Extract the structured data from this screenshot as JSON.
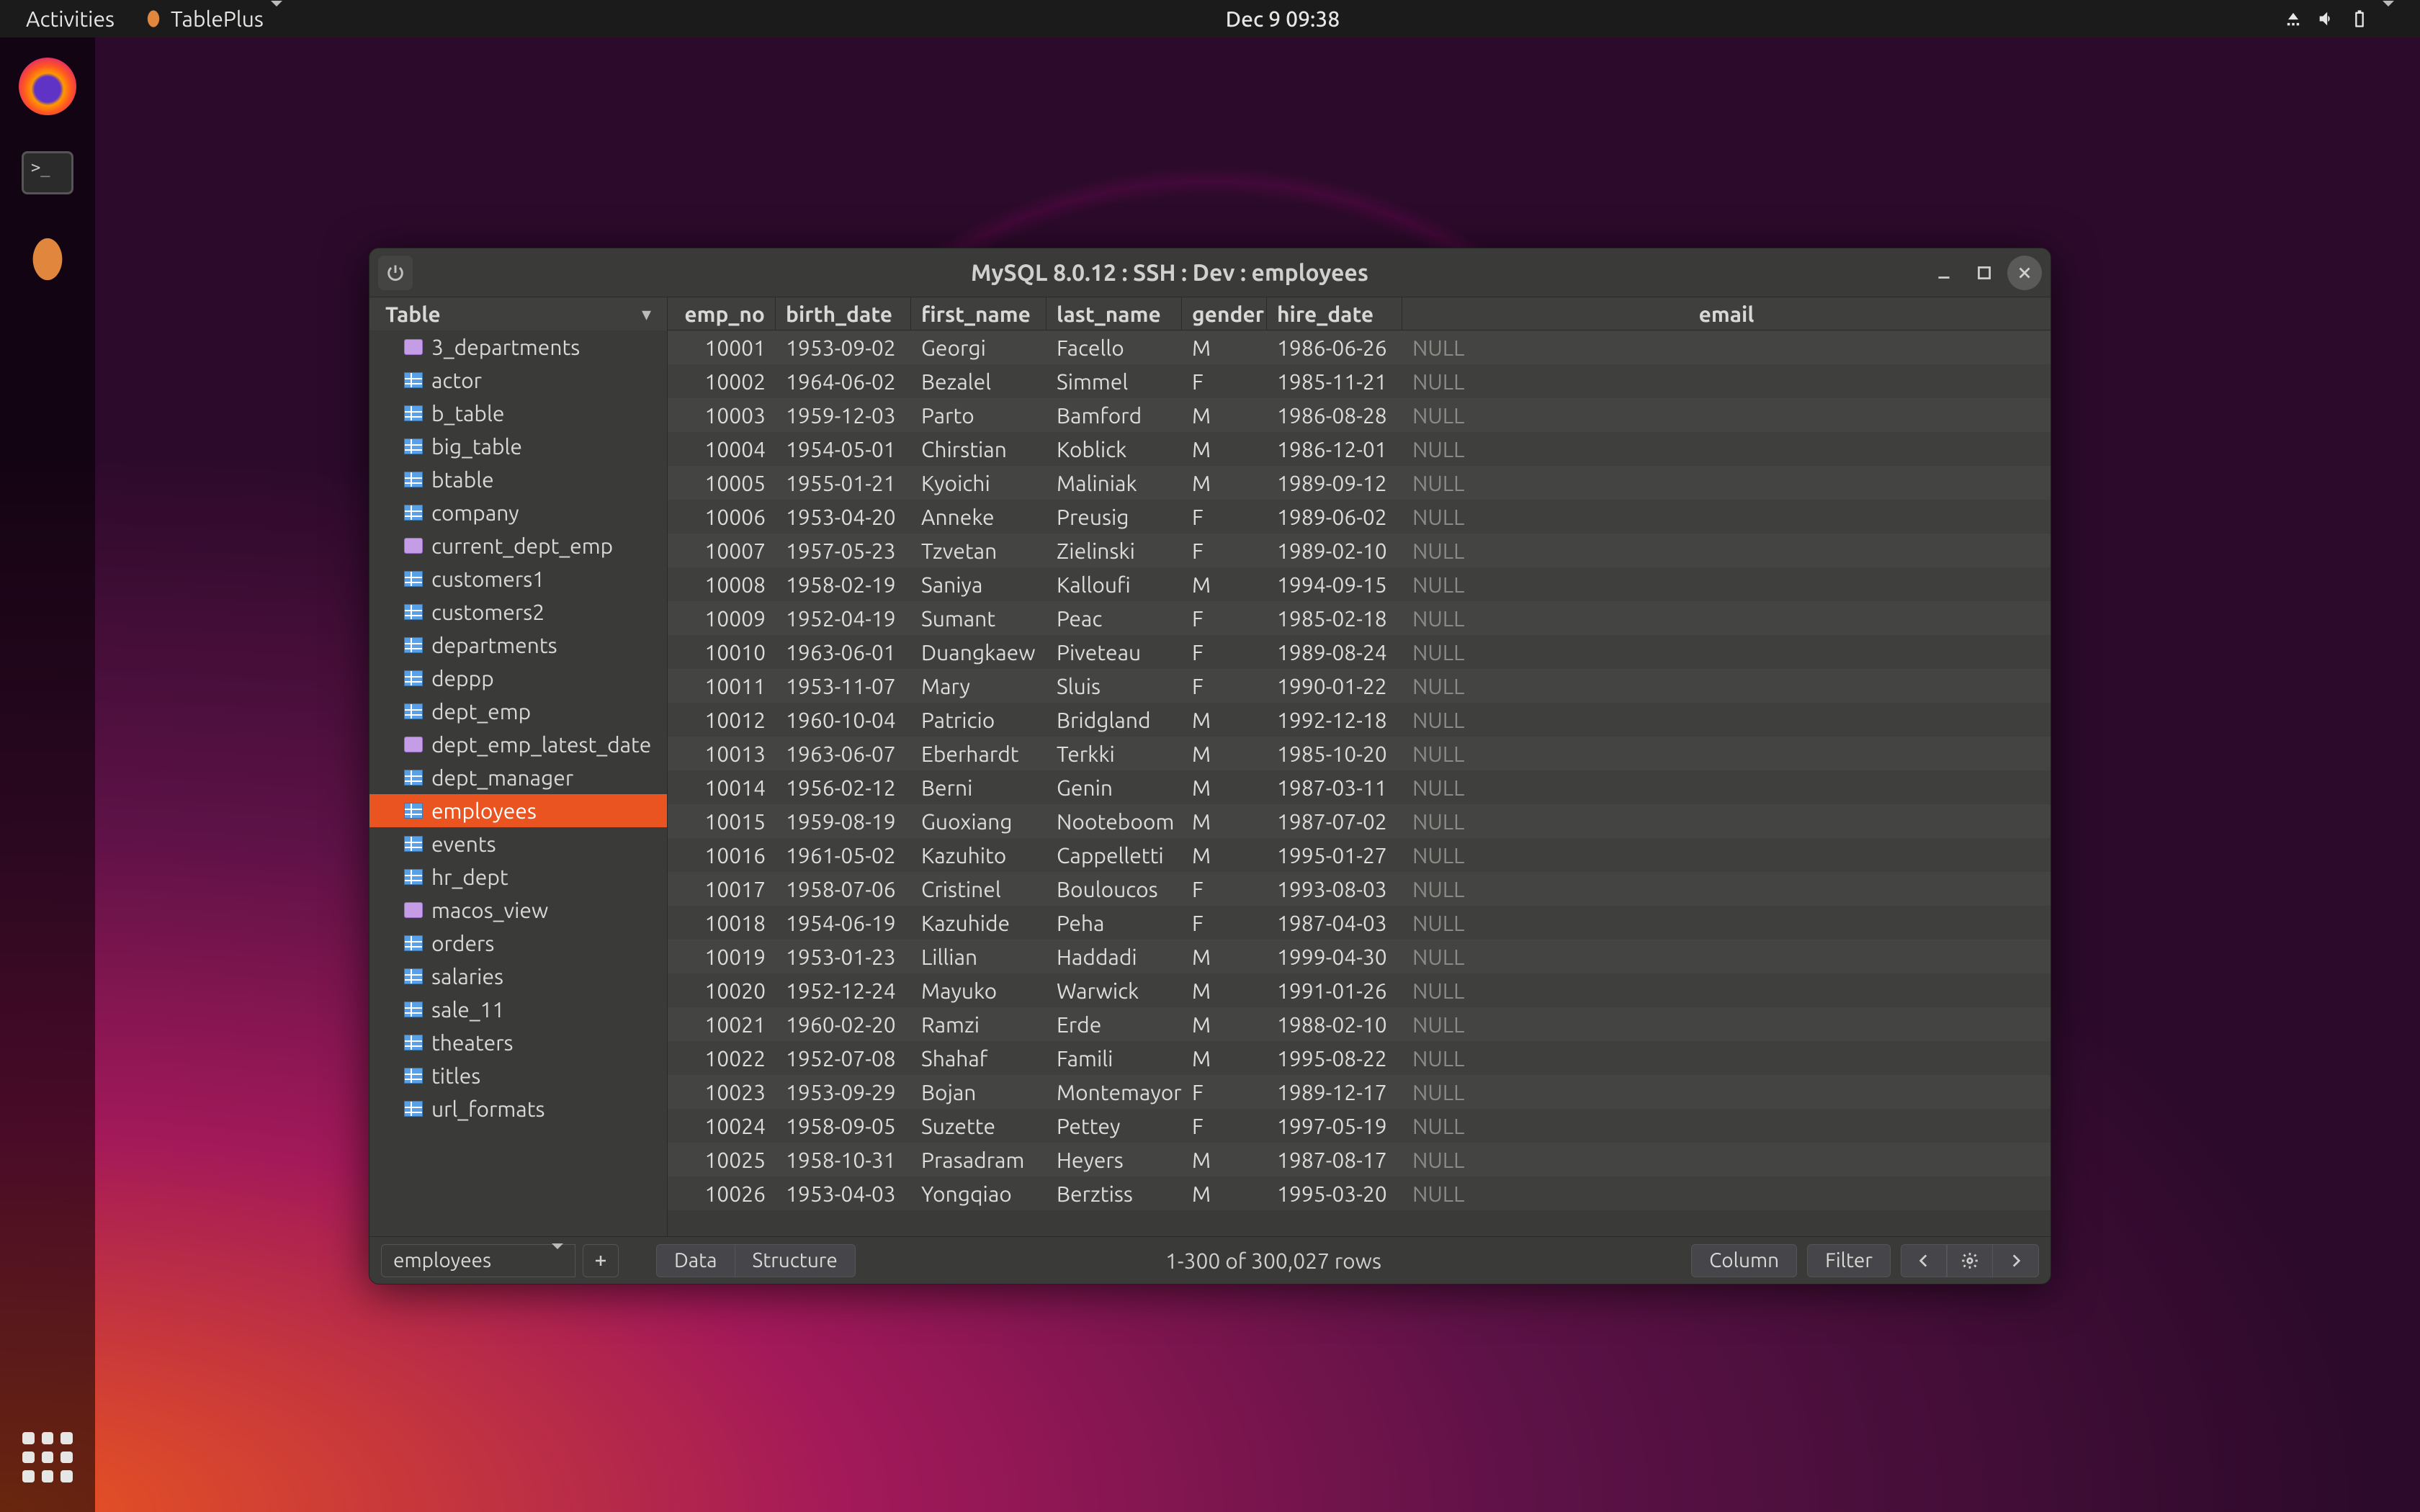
{
  "top_panel": {
    "activities": "Activities",
    "app_name": "TablePlus",
    "clock": "Dec 9  09:38"
  },
  "window": {
    "title": "MySQL 8.0.12  :  SSH  :  Dev  :  employees"
  },
  "sidebar": {
    "header": "Table",
    "tables": [
      {
        "name": "3_departments",
        "type": "view"
      },
      {
        "name": "actor",
        "type": "grid"
      },
      {
        "name": "b_table",
        "type": "grid"
      },
      {
        "name": "big_table",
        "type": "grid"
      },
      {
        "name": "btable",
        "type": "grid"
      },
      {
        "name": "company",
        "type": "grid"
      },
      {
        "name": "current_dept_emp",
        "type": "view"
      },
      {
        "name": "customers1",
        "type": "grid"
      },
      {
        "name": "customers2",
        "type": "grid"
      },
      {
        "name": "departments",
        "type": "grid"
      },
      {
        "name": "deppp",
        "type": "grid"
      },
      {
        "name": "dept_emp",
        "type": "grid"
      },
      {
        "name": "dept_emp_latest_date",
        "type": "view"
      },
      {
        "name": "dept_manager",
        "type": "grid"
      },
      {
        "name": "employees",
        "type": "grid",
        "selected": true
      },
      {
        "name": "events",
        "type": "grid"
      },
      {
        "name": "hr_dept",
        "type": "grid"
      },
      {
        "name": "macos_view",
        "type": "view"
      },
      {
        "name": "orders",
        "type": "grid"
      },
      {
        "name": "salaries",
        "type": "grid"
      },
      {
        "name": "sale_11",
        "type": "grid"
      },
      {
        "name": "theaters",
        "type": "grid"
      },
      {
        "name": "titles",
        "type": "grid"
      },
      {
        "name": "url_formats",
        "type": "grid"
      }
    ]
  },
  "columns": {
    "emp_no": "emp_no",
    "birth_date": "birth_date",
    "first_name": "first_name",
    "last_name": "last_name",
    "gender": "gender",
    "hire_date": "hire_date",
    "email": "email"
  },
  "rows": [
    {
      "emp_no": "10001",
      "birth_date": "1953-09-02",
      "first_name": "Georgi",
      "last_name": "Facello",
      "gender": "M",
      "hire_date": "1986-06-26",
      "email": "NULL"
    },
    {
      "emp_no": "10002",
      "birth_date": "1964-06-02",
      "first_name": "Bezalel",
      "last_name": "Simmel",
      "gender": "F",
      "hire_date": "1985-11-21",
      "email": "NULL"
    },
    {
      "emp_no": "10003",
      "birth_date": "1959-12-03",
      "first_name": "Parto",
      "last_name": "Bamford",
      "gender": "M",
      "hire_date": "1986-08-28",
      "email": "NULL"
    },
    {
      "emp_no": "10004",
      "birth_date": "1954-05-01",
      "first_name": "Chirstian",
      "last_name": "Koblick",
      "gender": "M",
      "hire_date": "1986-12-01",
      "email": "NULL"
    },
    {
      "emp_no": "10005",
      "birth_date": "1955-01-21",
      "first_name": "Kyoichi",
      "last_name": "Maliniak",
      "gender": "M",
      "hire_date": "1989-09-12",
      "email": "NULL"
    },
    {
      "emp_no": "10006",
      "birth_date": "1953-04-20",
      "first_name": "Anneke",
      "last_name": "Preusig",
      "gender": "F",
      "hire_date": "1989-06-02",
      "email": "NULL"
    },
    {
      "emp_no": "10007",
      "birth_date": "1957-05-23",
      "first_name": "Tzvetan",
      "last_name": "Zielinski",
      "gender": "F",
      "hire_date": "1989-02-10",
      "email": "NULL"
    },
    {
      "emp_no": "10008",
      "birth_date": "1958-02-19",
      "first_name": "Saniya",
      "last_name": "Kalloufi",
      "gender": "M",
      "hire_date": "1994-09-15",
      "email": "NULL"
    },
    {
      "emp_no": "10009",
      "birth_date": "1952-04-19",
      "first_name": "Sumant",
      "last_name": "Peac",
      "gender": "F",
      "hire_date": "1985-02-18",
      "email": "NULL"
    },
    {
      "emp_no": "10010",
      "birth_date": "1963-06-01",
      "first_name": "Duangkaew",
      "last_name": "Piveteau",
      "gender": "F",
      "hire_date": "1989-08-24",
      "email": "NULL"
    },
    {
      "emp_no": "10011",
      "birth_date": "1953-11-07",
      "first_name": "Mary",
      "last_name": "Sluis",
      "gender": "F",
      "hire_date": "1990-01-22",
      "email": "NULL"
    },
    {
      "emp_no": "10012",
      "birth_date": "1960-10-04",
      "first_name": "Patricio",
      "last_name": "Bridgland",
      "gender": "M",
      "hire_date": "1992-12-18",
      "email": "NULL"
    },
    {
      "emp_no": "10013",
      "birth_date": "1963-06-07",
      "first_name": "Eberhardt",
      "last_name": "Terkki",
      "gender": "M",
      "hire_date": "1985-10-20",
      "email": "NULL"
    },
    {
      "emp_no": "10014",
      "birth_date": "1956-02-12",
      "first_name": "Berni",
      "last_name": "Genin",
      "gender": "M",
      "hire_date": "1987-03-11",
      "email": "NULL"
    },
    {
      "emp_no": "10015",
      "birth_date": "1959-08-19",
      "first_name": "Guoxiang",
      "last_name": "Nooteboom",
      "gender": "M",
      "hire_date": "1987-07-02",
      "email": "NULL"
    },
    {
      "emp_no": "10016",
      "birth_date": "1961-05-02",
      "first_name": "Kazuhito",
      "last_name": "Cappelletti",
      "gender": "M",
      "hire_date": "1995-01-27",
      "email": "NULL"
    },
    {
      "emp_no": "10017",
      "birth_date": "1958-07-06",
      "first_name": "Cristinel",
      "last_name": "Bouloucos",
      "gender": "F",
      "hire_date": "1993-08-03",
      "email": "NULL"
    },
    {
      "emp_no": "10018",
      "birth_date": "1954-06-19",
      "first_name": "Kazuhide",
      "last_name": "Peha",
      "gender": "F",
      "hire_date": "1987-04-03",
      "email": "NULL"
    },
    {
      "emp_no": "10019",
      "birth_date": "1953-01-23",
      "first_name": "Lillian",
      "last_name": "Haddadi",
      "gender": "M",
      "hire_date": "1999-04-30",
      "email": "NULL"
    },
    {
      "emp_no": "10020",
      "birth_date": "1952-12-24",
      "first_name": "Mayuko",
      "last_name": "Warwick",
      "gender": "M",
      "hire_date": "1991-01-26",
      "email": "NULL"
    },
    {
      "emp_no": "10021",
      "birth_date": "1960-02-20",
      "first_name": "Ramzi",
      "last_name": "Erde",
      "gender": "M",
      "hire_date": "1988-02-10",
      "email": "NULL"
    },
    {
      "emp_no": "10022",
      "birth_date": "1952-07-08",
      "first_name": "Shahaf",
      "last_name": "Famili",
      "gender": "M",
      "hire_date": "1995-08-22",
      "email": "NULL"
    },
    {
      "emp_no": "10023",
      "birth_date": "1953-09-29",
      "first_name": "Bojan",
      "last_name": "Montemayor",
      "gender": "F",
      "hire_date": "1989-12-17",
      "email": "NULL"
    },
    {
      "emp_no": "10024",
      "birth_date": "1958-09-05",
      "first_name": "Suzette",
      "last_name": "Pettey",
      "gender": "F",
      "hire_date": "1997-05-19",
      "email": "NULL"
    },
    {
      "emp_no": "10025",
      "birth_date": "1958-10-31",
      "first_name": "Prasadram",
      "last_name": "Heyers",
      "gender": "M",
      "hire_date": "1987-08-17",
      "email": "NULL"
    },
    {
      "emp_no": "10026",
      "birth_date": "1953-04-03",
      "first_name": "Yongqiao",
      "last_name": "Berztiss",
      "gender": "M",
      "hire_date": "1995-03-20",
      "email": "NULL"
    }
  ],
  "bottom": {
    "selected_table": "employees",
    "data_tab": "Data",
    "structure_tab": "Structure",
    "status": "1-300 of 300,027 rows",
    "column_btn": "Column",
    "filter_btn": "Filter"
  }
}
